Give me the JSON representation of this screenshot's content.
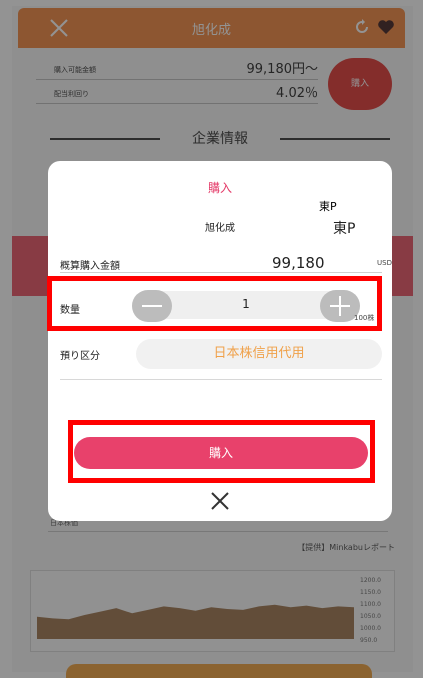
{
  "background": {
    "header_title": "旭化成",
    "summary": [
      {
        "label": "購入可能金額",
        "value": "99,180円〜"
      },
      {
        "label": "配当利回り",
        "value": "4.02％"
      }
    ],
    "buy_circle_label": "購入",
    "section_title": "企業情報",
    "news_row_label": "日本株価",
    "news_source": "【提供】Minkabuレポート",
    "chart_data": {
      "type": "area",
      "color": "#8b5a2b",
      "values": [
        1030,
        1020,
        1015,
        1040,
        1060,
        1080,
        1050,
        1070,
        1090,
        1080,
        1065,
        1085,
        1075,
        1070,
        1090,
        1100,
        1085,
        1095,
        1080,
        1090,
        1085
      ],
      "ylim": [
        900,
        1250
      ],
      "tick_labels": [
        "1200.0",
        "1150.0",
        "1100.0",
        "1050.0",
        "1000.0",
        "950.0"
      ]
    }
  },
  "modal": {
    "title": "購入",
    "stock_name": "旭化成",
    "market_float": "東P",
    "market": "東P",
    "amount_label": "概算購入金額",
    "amount_value": "99,180",
    "amount_unit": "USD",
    "qty_label": "数量",
    "qty_value": "1",
    "qty_unit": "100株",
    "account_label": "預り区分",
    "account_value": "日本株信用代用",
    "buy_button": "購入"
  },
  "colors": {
    "header_orange": "#f2853a",
    "pink": "#e8416b",
    "account_text": "#f0a14a",
    "annotation_red": "#ff0000"
  },
  "icons": [
    "close-icon",
    "refresh-icon",
    "heart-icon",
    "minus-icon",
    "plus-icon"
  ]
}
